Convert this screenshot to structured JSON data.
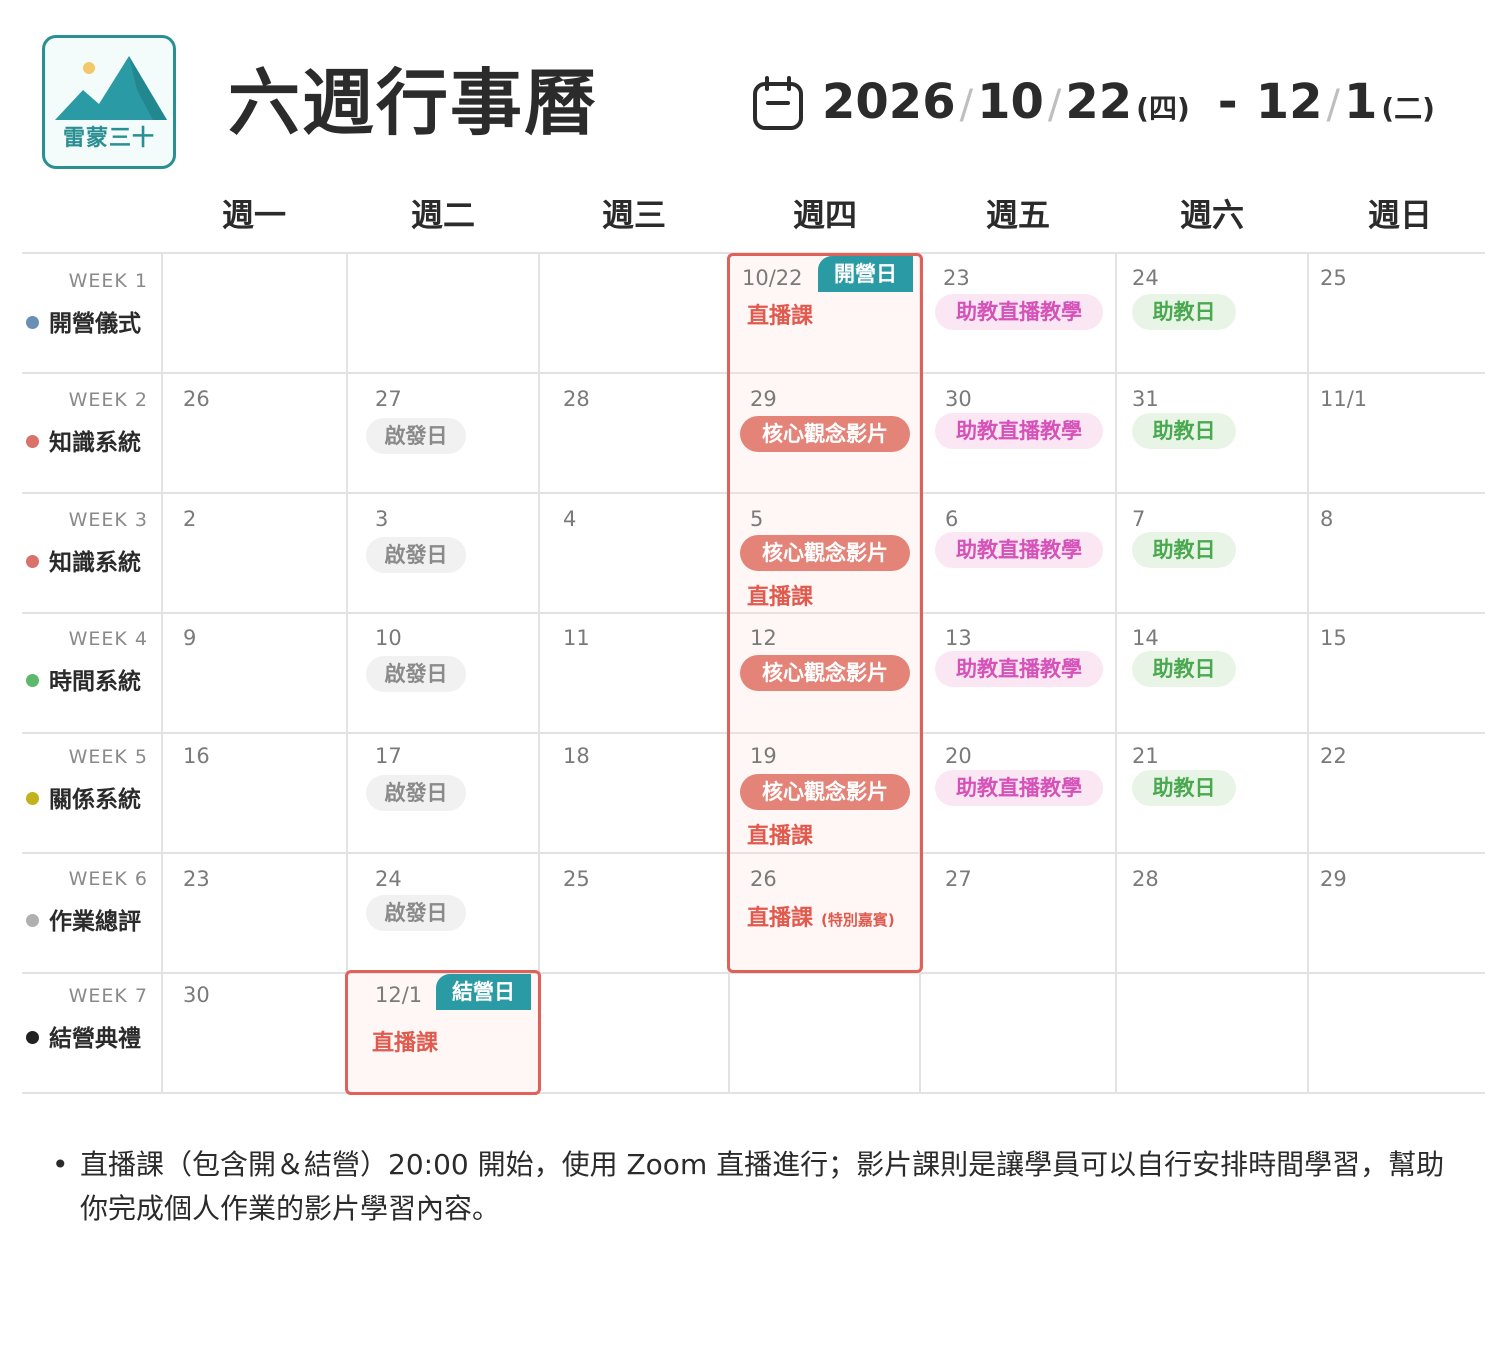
{
  "brand": {
    "logo_text": "雷蒙三十"
  },
  "header": {
    "title": "六週行事曆",
    "date_start": {
      "year": "2026",
      "month": "10",
      "day": "22",
      "weekday": "(四)"
    },
    "dash": "-",
    "date_end": {
      "month": "12",
      "day": "1",
      "weekday": "(二)"
    },
    "slash": "/"
  },
  "weekdays": [
    "週一",
    "週二",
    "週三",
    "週四",
    "週五",
    "週六",
    "週日"
  ],
  "weeks": [
    {
      "label": "WEEK 1",
      "name": "開營儀式",
      "color": "#6a8fb5"
    },
    {
      "label": "WEEK 2",
      "name": "知識系統",
      "color": "#d9726a"
    },
    {
      "label": "WEEK 3",
      "name": "知識系統",
      "color": "#d9726a"
    },
    {
      "label": "WEEK 4",
      "name": "時間系統",
      "color": "#5cb86a"
    },
    {
      "label": "WEEK 5",
      "name": "關係系統",
      "color": "#c2b31c"
    },
    {
      "label": "WEEK 6",
      "name": "作業總評",
      "color": "#b0b0b0"
    },
    {
      "label": "WEEK 7",
      "name": "結營典禮",
      "color": "#222222"
    }
  ],
  "dates": [
    [
      "",
      "",
      "",
      "10/22",
      "23",
      "24",
      "25"
    ],
    [
      "26",
      "27",
      "28",
      "29",
      "30",
      "31",
      "11/1"
    ],
    [
      "2",
      "3",
      "4",
      "5",
      "6",
      "7",
      "8"
    ],
    [
      "9",
      "10",
      "11",
      "12",
      "13",
      "14",
      "15"
    ],
    [
      "16",
      "17",
      "18",
      "19",
      "20",
      "21",
      "22"
    ],
    [
      "23",
      "24",
      "25",
      "26",
      "27",
      "28",
      "29"
    ],
    [
      "30",
      "12/1",
      "",
      "",
      "",
      "",
      ""
    ]
  ],
  "events": {
    "opening_badge": "開營日",
    "closing_badge": "結營日",
    "live_class": "直播課",
    "core_video": "核心觀念影片",
    "ta_live": "助教直播教學",
    "ta_day": "助教日",
    "inspiration_day": "啟發日",
    "special_guest": "(特別嘉賓)"
  },
  "note": "直播課（包含開＆結營）20:00 開始，使用 Zoom 直播進行；影片課則是讓學員可以自行安排時間學習，幫助你完成個人作業的影片學習內容。",
  "colors": {
    "teal": "#2a9aa4",
    "red": "#e0605a",
    "pink_text": "#d552b8",
    "green_text": "#4aa950"
  }
}
